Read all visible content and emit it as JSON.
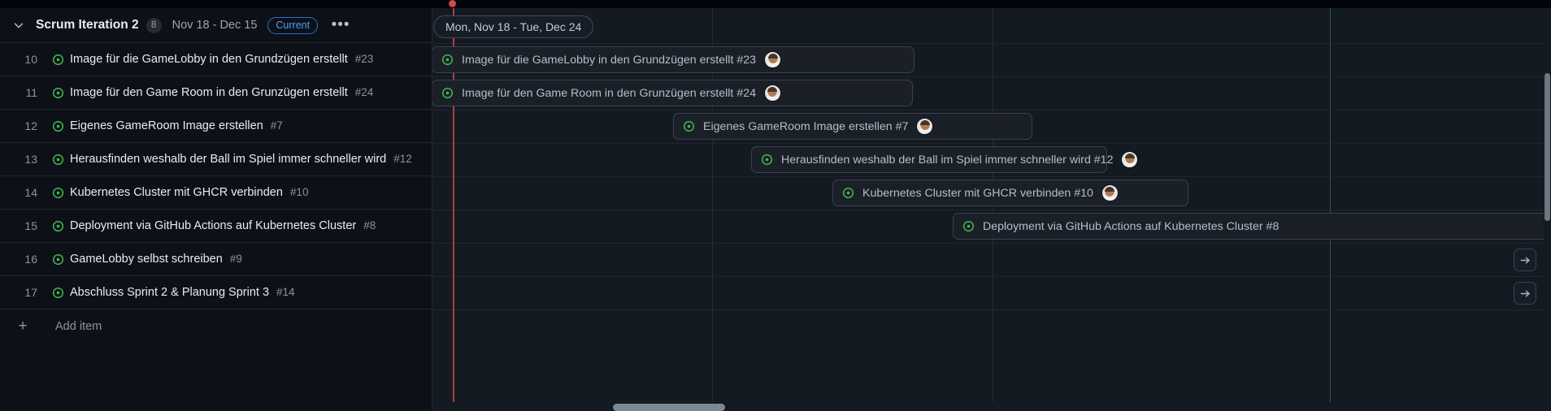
{
  "app": {
    "theme_bg": "#0d1117",
    "accent": "#4a9eff",
    "today_line_color": "#a8403f"
  },
  "iteration_header": {
    "collapse_icon": "chevron-down-icon",
    "title": "Scrum Iteration 2",
    "item_count": "8",
    "date_range": "Nov 18 - Dec 15",
    "status_badge": "Current",
    "more_menu": "•••"
  },
  "rows": [
    {
      "num": "10",
      "icon": "issue-open-icon",
      "title": "Image für die GameLobby in den Grundzügen erstellt",
      "ref": "#23"
    },
    {
      "num": "11",
      "icon": "issue-open-icon",
      "title": "Image für den Game Room in den Grunzügen erstellt",
      "ref": "#24"
    },
    {
      "num": "12",
      "icon": "issue-open-icon",
      "title": "Eigenes GameRoom Image erstellen",
      "ref": "#7"
    },
    {
      "num": "13",
      "icon": "issue-open-icon",
      "title": "Herausfinden weshalb der Ball im Spiel immer schneller wird",
      "ref": "#12"
    },
    {
      "num": "14",
      "icon": "issue-open-icon",
      "title": "Kubernetes Cluster mit GHCR verbinden",
      "ref": "#10"
    },
    {
      "num": "15",
      "icon": "issue-open-icon",
      "title": "Deployment via GitHub Actions auf Kubernetes Cluster",
      "ref": "#8"
    },
    {
      "num": "16",
      "icon": "issue-open-icon",
      "title": "GameLobby selbst schreiben",
      "ref": "#9"
    },
    {
      "num": "17",
      "icon": "issue-open-icon",
      "title": "Abschluss Sprint 2 & Planung Sprint 3",
      "ref": "#14"
    }
  ],
  "add_item": {
    "plus_icon": "plus-icon",
    "label": "Add item"
  },
  "timeline": {
    "iteration_capsule": "Mon, Nov 18 - Tue, Dec 24",
    "bars": [
      {
        "label": "Image für die GameLobby in den Grundzügen erstellt #23",
        "has_avatar": true
      },
      {
        "label": "Image für den Game Room in den Grunzügen erstellt #24",
        "has_avatar": true
      },
      {
        "label": "Eigenes GameRoom Image erstellen #7",
        "has_avatar": true
      },
      {
        "label": "Herausfinden weshalb der Ball im Spiel immer schneller wird #12",
        "has_avatar": true
      },
      {
        "label": "Kubernetes Cluster mit GHCR verbinden #10",
        "has_avatar": true
      },
      {
        "label": "Deployment via GitHub Actions auf Kubernetes Cluster #8",
        "has_avatar": false
      }
    ],
    "offscreen_arrows": [
      {
        "icon": "arrow-right-icon",
        "row": "16"
      },
      {
        "icon": "arrow-right-icon",
        "row": "17"
      }
    ]
  }
}
